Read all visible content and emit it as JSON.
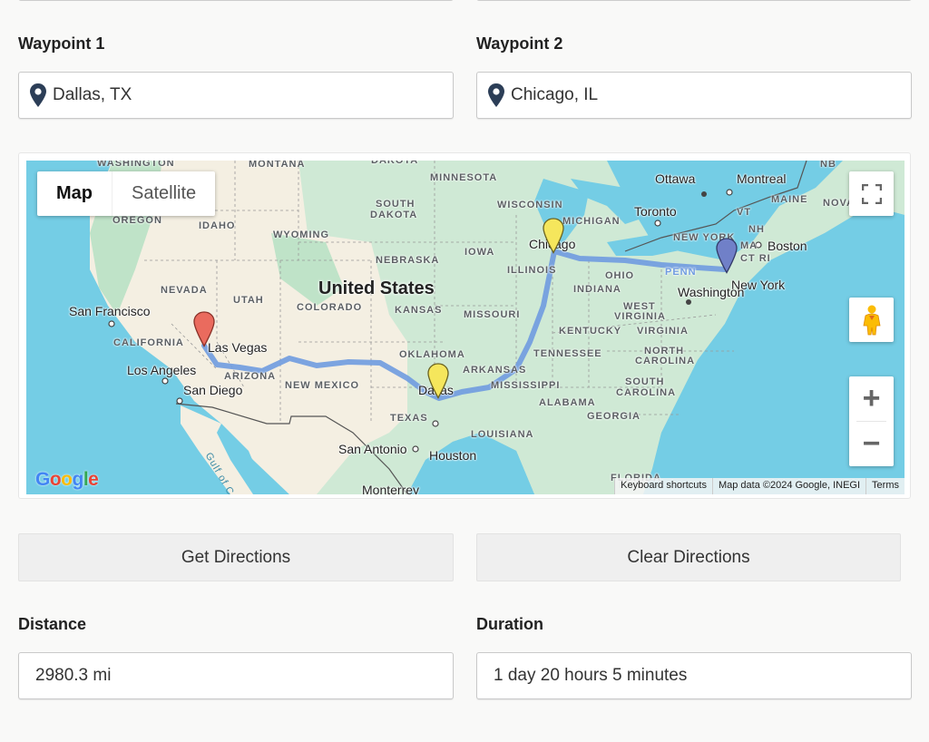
{
  "form": {
    "waypoint1": {
      "label": "Waypoint 1",
      "value": "Dallas, TX",
      "icon": "map-pin-icon"
    },
    "waypoint2": {
      "label": "Waypoint 2",
      "value": "Chicago, IL",
      "icon": "map-pin-icon"
    }
  },
  "map": {
    "type_control": {
      "map_label": "Map",
      "satellite_label": "Satellite",
      "selected": "Map"
    },
    "controls": {
      "fullscreen_icon": "fullscreen-icon",
      "pegman_icon": "street-view-pegman-icon",
      "zoom_in_label": "+",
      "zoom_out_label": "−"
    },
    "logo": "Google",
    "attribution": {
      "shortcuts": "Keyboard shortcuts",
      "data": "Map data ©2024 Google, INEGI",
      "terms": "Terms"
    },
    "country_label": "United States",
    "state_labels": [
      "WASHINGTON",
      "MONTANA",
      "DAKOTA",
      "MINNESOTA",
      "OREGON",
      "IDAHO",
      "WYOMING",
      "SOUTH",
      "DAKOTA",
      "WISCONSIN",
      "MICHIGAN",
      "IOWA",
      "NEBRASKA",
      "ILLINOIS",
      "NEVADA",
      "UTAH",
      "COLORADO",
      "KANSAS",
      "MISSOURI",
      "INDIANA",
      "OHIO",
      "PENN",
      "NEW YORK",
      "VT",
      "NH",
      "MAINE",
      "MA",
      "CT RI",
      "NB",
      "NOVA",
      "WEST",
      "VIRGINIA",
      "KENTUCKY",
      "VIRGINIA",
      "CALIFORNIA",
      "ARIZONA",
      "NEW MEXICO",
      "OKLAHOMA",
      "TENNESSEE",
      "NORTH",
      "CAROLINA",
      "ARKANSAS",
      "MISSISSIPPI",
      "SOUTH",
      "CAROLINA",
      "ALABAMA",
      "GEORGIA",
      "TEXAS",
      "LOUISIANA",
      "FLORIDA"
    ],
    "city_labels": [
      "Ottawa",
      "Montreal",
      "Toronto",
      "Boston",
      "Chicago",
      "New York",
      "Washington",
      "San Francisco",
      "Las Vegas",
      "Los Angeles",
      "San Diego",
      "Dallas",
      "San Antonio",
      "Houston",
      "Monterrey"
    ],
    "water_labels": [
      "Gulf of California"
    ],
    "route": {
      "color": "#6f9be0",
      "stops": [
        {
          "name": "Las Vegas",
          "marker_color": "#ea6b5e"
        },
        {
          "name": "Dallas",
          "marker_color": "#f5e65c"
        },
        {
          "name": "Chicago",
          "marker_color": "#f5e65c"
        },
        {
          "name": "New York",
          "marker_color": "#7080c8"
        }
      ]
    }
  },
  "actions": {
    "get_directions": "Get Directions",
    "clear_directions": "Clear Directions"
  },
  "results": {
    "distance": {
      "label": "Distance",
      "value": "2980.3 mi"
    },
    "duration": {
      "label": "Duration",
      "value": "1 day 20 hours 5 minutes"
    }
  },
  "colors": {
    "page_bg": "#f9f9f8",
    "pin_icon": "#2c3e57",
    "water": "#74cde5",
    "land": "#cfe9d5",
    "desert": "#f4efe2",
    "button_bg": "#efefef"
  }
}
